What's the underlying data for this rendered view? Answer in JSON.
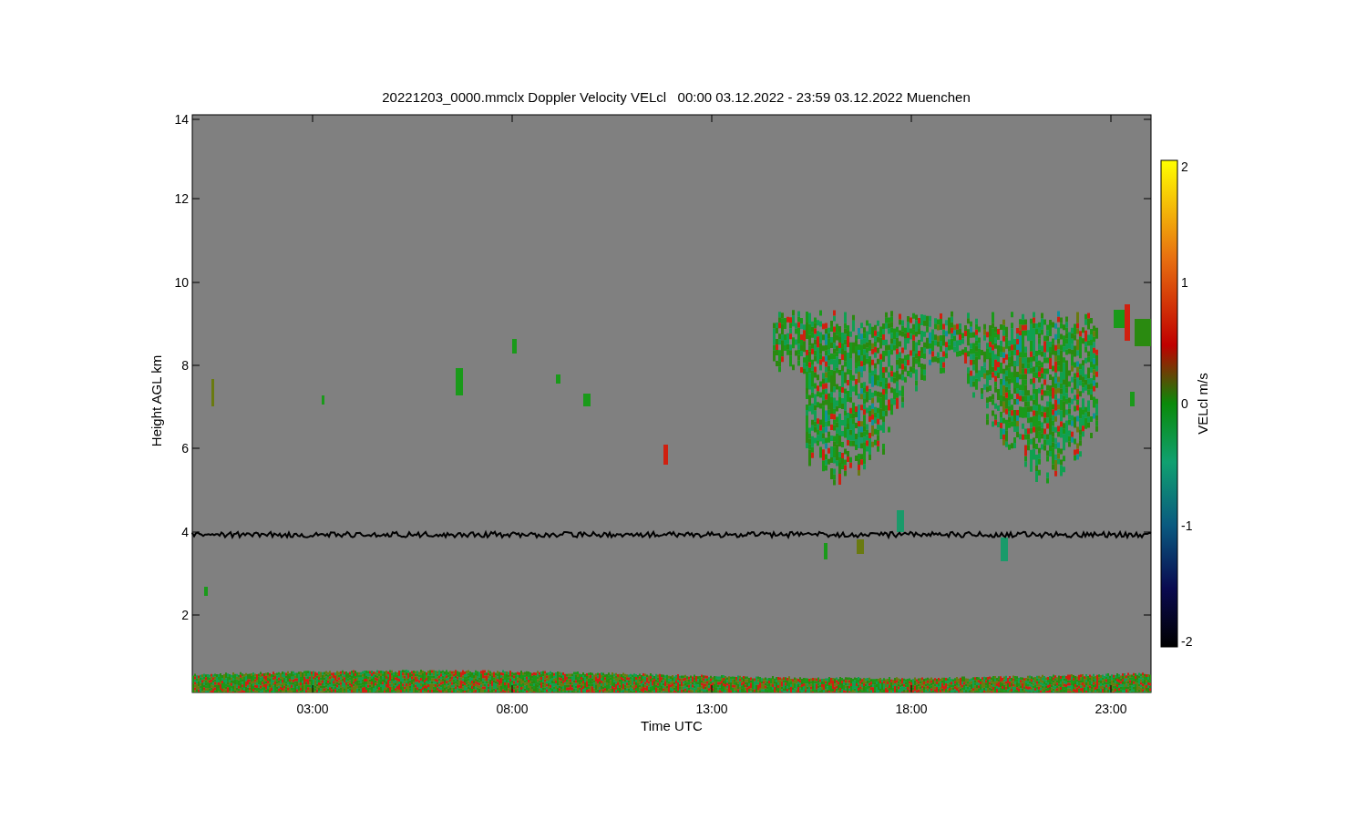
{
  "title": "20221203_0000.mmclx Doppler Velocity VELcl   00:00 03.12.2022 - 23:59 03.12.2022 Muenchen",
  "y_axis": {
    "label": "Height AGL km",
    "ticks": [
      "14",
      "12",
      "10",
      "8",
      "6",
      "4",
      "2"
    ]
  },
  "x_axis": {
    "label": "Time UTC",
    "ticks": [
      "03:00",
      "08:00",
      "13:00",
      "18:00",
      "23:00"
    ]
  },
  "colorbar": {
    "label": "VELcl m/s",
    "ticks": [
      "2",
      "1",
      "0",
      "-1",
      "-2"
    ]
  }
}
